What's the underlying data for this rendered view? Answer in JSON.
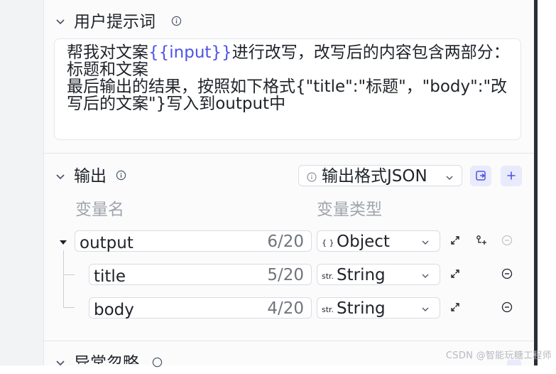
{
  "prompt_section": {
    "title": "用户提示词",
    "text_before": "帮我对文案",
    "variable": "{{input}}",
    "text_after": "进行改写，改写后的内容包含两部分：标题和文案\n最后输出的结果，按照如下格式{\"title\":\"标题\"，\"body\":\"改写后的文案\"}写入到output中"
  },
  "output_section": {
    "title": "输出",
    "format_select": {
      "value": "输出格式JSON"
    },
    "columns": {
      "name": "变量名",
      "type": "变量类型"
    },
    "rows": [
      {
        "name": "output",
        "count": "6/20",
        "type_icon": "{ }",
        "type": "Object"
      },
      {
        "name": "title",
        "count": "5/20",
        "type_icon": "str.",
        "type": "String"
      },
      {
        "name": "body",
        "count": "4/20",
        "type_icon": "str.",
        "type": "String"
      }
    ]
  },
  "exception_section": {
    "title": "异常忽略"
  },
  "watermark": "CSDN @智能玩糖工程师",
  "colors": {
    "accent": "#4d53e8",
    "border": "#d9dce3",
    "muted": "#a0a4ab"
  }
}
